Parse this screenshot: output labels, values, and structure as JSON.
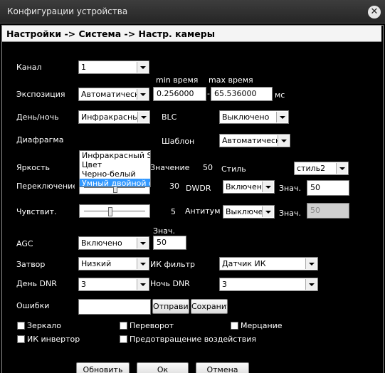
{
  "window": {
    "title": "Конфигурации устройства",
    "close_symbol": "✕"
  },
  "breadcrumb": "Настройки -> Система -> Настр. камеры",
  "channel": {
    "label": "Канал",
    "value": "1"
  },
  "exposure": {
    "label": "Экспозиция",
    "mode": "Автоматически",
    "min_label": "min время",
    "max_label": "max время",
    "min_value": "0.256000",
    "separator": "-",
    "max_value": "65.536000",
    "unit": "мс"
  },
  "day_night": {
    "label": "День/ночь",
    "value": "Инфракрасный",
    "options": [
      "Инфракрасный Star",
      "Цвет",
      "Черно-белый",
      "Умный двойной свет"
    ],
    "highlighted_index": 3
  },
  "blc": {
    "label": "BLC",
    "value": "Выключено"
  },
  "aperture": {
    "label": "Диафрагма"
  },
  "template": {
    "label": "Шаблон",
    "value": "Автоматически"
  },
  "brightness": {
    "label": "Яркость",
    "value": "50",
    "value_label": "Значение",
    "value_display": "50"
  },
  "style": {
    "label": "Стиль",
    "value": "стиль2"
  },
  "switch": {
    "label": "Переключение д/н",
    "display": "30",
    "level": 0.5
  },
  "dwdr": {
    "label": "DWDR",
    "value": "Включено",
    "value_label": "Знач.",
    "value_input": "50"
  },
  "sensitivity": {
    "label": "Чувствит.",
    "display": "5",
    "level": 0.42
  },
  "antifog": {
    "label": "Антитумана",
    "value": "Выключено",
    "value_label": "Знач.",
    "value_input": "50"
  },
  "agc": {
    "label": "AGC",
    "value": "Включено",
    "value_label": "Знач.",
    "value_input": "50"
  },
  "shutter": {
    "label": "Затвор",
    "value": "Низкий"
  },
  "ir_filter": {
    "label": "ИК фильтр",
    "value": "Датчик ИК"
  },
  "day_dnr": {
    "label": "День DNR",
    "value": "3"
  },
  "night_dnr": {
    "label": "Ночь DNR",
    "value": "3"
  },
  "errors": {
    "label": "Ошибки",
    "value": ""
  },
  "buttons": {
    "send": "Отправить",
    "save": "Сохранить",
    "refresh": "Обновить",
    "ok": "Ок",
    "cancel": "Отмена"
  },
  "checkboxes": {
    "mirror": "Зеркало",
    "flip": "Переворот",
    "flicker": "Мерцание",
    "ir_inverter": "ИК инвертор",
    "tamper": "Предотвращение воздействия"
  }
}
